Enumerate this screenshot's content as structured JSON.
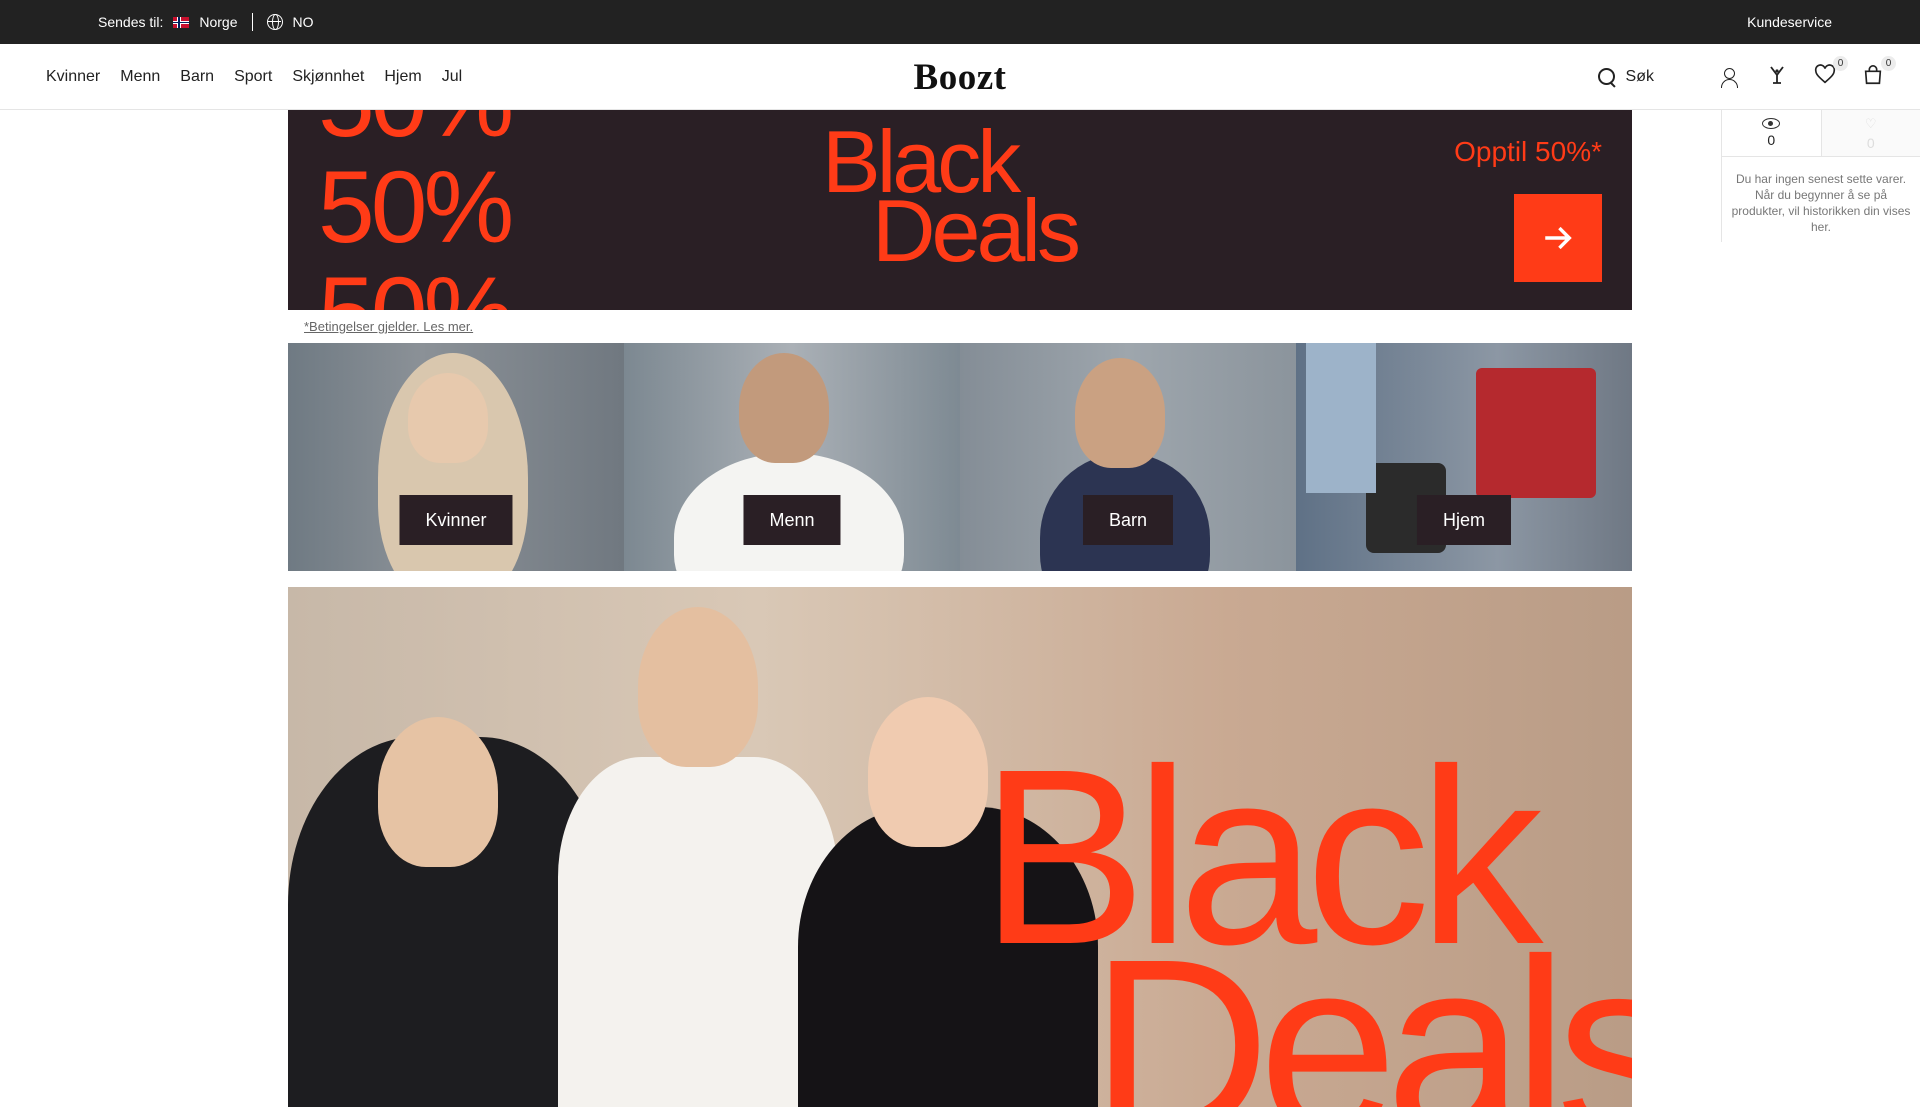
{
  "topbar": {
    "ship_label": "Sendes til:",
    "country": "Norge",
    "language": "NO",
    "customer_service": "Kundeservice"
  },
  "header": {
    "nav": [
      "Kvinner",
      "Menn",
      "Barn",
      "Sport",
      "Skjønnhet",
      "Hjem",
      "Jul"
    ],
    "logo": "Boozt",
    "search_label": "Søk",
    "wishlist_count": "0",
    "cart_count": "0"
  },
  "hero_banner": {
    "percent_text": "50%",
    "title_line1": "Black",
    "title_line2": "Deals",
    "upto": "Opptil 50%*",
    "terms": "*Betingelser gjelder. Les mer.",
    "accent_color": "#ff3b17",
    "background_color": "#2a1f25"
  },
  "categories": [
    {
      "label": "Kvinner"
    },
    {
      "label": "Menn"
    },
    {
      "label": "Barn"
    },
    {
      "label": "Hjem"
    }
  ],
  "hero2": {
    "title_line1": "Black",
    "title_line2": "Deals"
  },
  "recent_panel": {
    "viewed_count": "0",
    "favorites_count": "0",
    "message": "Du har ingen senest sette varer. Når du begynner å se på produkter, vil historikken din vises her."
  }
}
